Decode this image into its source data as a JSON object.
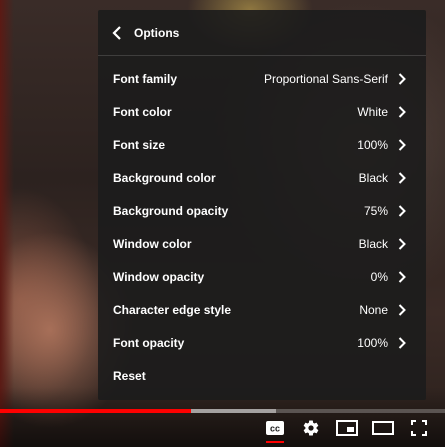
{
  "menu": {
    "title": "Options",
    "items": [
      {
        "label": "Font family",
        "value": "Proportional Sans-Serif"
      },
      {
        "label": "Font color",
        "value": "White"
      },
      {
        "label": "Font size",
        "value": "100%"
      },
      {
        "label": "Background color",
        "value": "Black"
      },
      {
        "label": "Background opacity",
        "value": "75%"
      },
      {
        "label": "Window color",
        "value": "Black"
      },
      {
        "label": "Window opacity",
        "value": "0%"
      },
      {
        "label": "Character edge style",
        "value": "None"
      },
      {
        "label": "Font opacity",
        "value": "100%"
      },
      {
        "label": "Reset",
        "value": ""
      }
    ]
  },
  "player": {
    "progress_played_fraction": 0.43,
    "progress_buffered_fraction": 0.62,
    "accent_color": "#ff0000"
  },
  "icons": {
    "back": "chevron-left-icon",
    "item_arrow": "chevron-right-icon",
    "subtitles": "closed-captions-icon",
    "settings": "gear-icon",
    "miniplayer": "miniplayer-icon",
    "theater": "theater-mode-icon",
    "fullscreen": "fullscreen-icon"
  }
}
